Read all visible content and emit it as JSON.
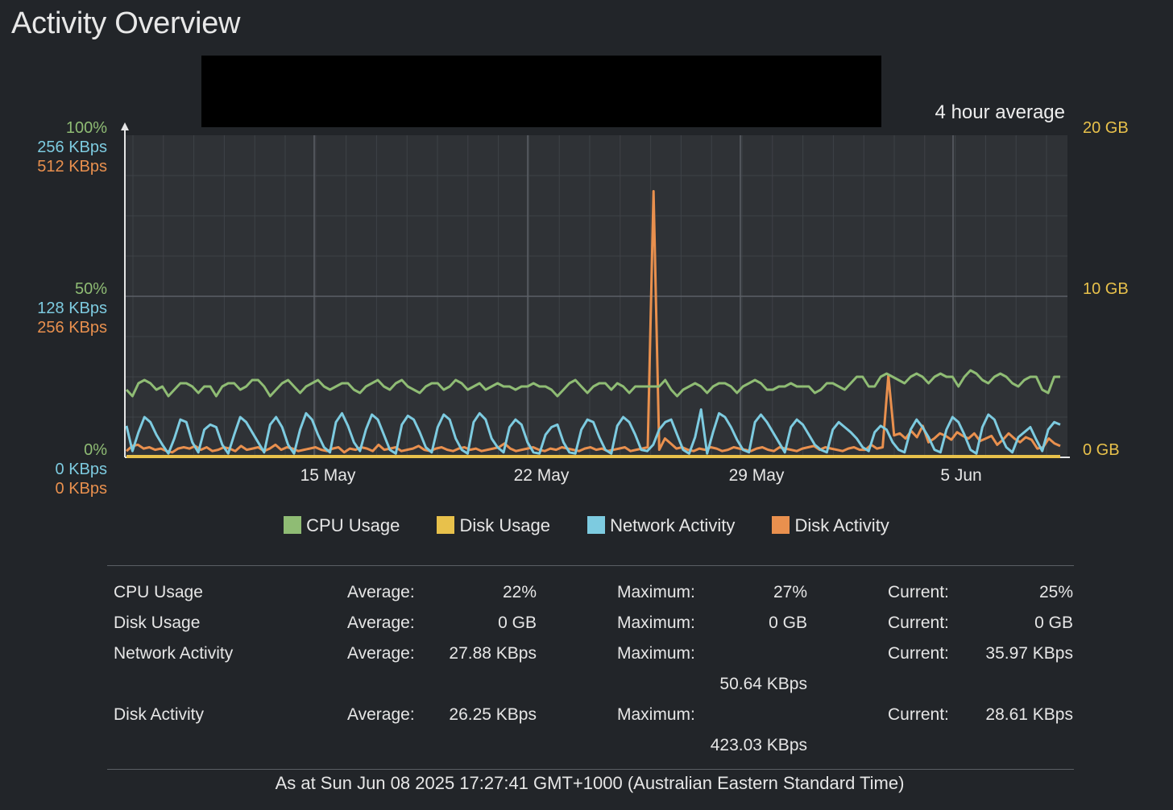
{
  "page": {
    "title": "Activity Overview",
    "average_label": "4 hour average"
  },
  "colors": {
    "cpu": "#8fbc74",
    "disk_usage": "#e8c14b",
    "network": "#7dcbe0",
    "disk_activity": "#e9904e"
  },
  "chart_data": {
    "type": "line",
    "title": "",
    "y_left_labels": {
      "top": [
        "100%",
        "256 KBps",
        "512 KBps"
      ],
      "mid": [
        "50%",
        "128 KBps",
        "256 KBps"
      ],
      "bottom": [
        "0%",
        "0 KBps",
        "0 KBps"
      ]
    },
    "y_right_labels": [
      "20 GB",
      "10 GB",
      "0 GB"
    ],
    "x_ticks": [
      "15 May",
      "22 May",
      "29 May",
      "5 Jun"
    ],
    "ylim_cpu": [
      0,
      100
    ],
    "ylim_network_kbps": [
      0,
      256
    ],
    "ylim_disk_activity_kbps": [
      0,
      512
    ],
    "ylim_disk_usage_gb": [
      0,
      20
    ],
    "grid": true,
    "series": [
      {
        "name": "CPU Usage",
        "unit": "%",
        "values": [
          21,
          19,
          23,
          24,
          23,
          21,
          22,
          19,
          21,
          23,
          23,
          22,
          20,
          22,
          22,
          19,
          22,
          23,
          23,
          21,
          22,
          24,
          24,
          22,
          19,
          21,
          23,
          24,
          22,
          20,
          22,
          23,
          24,
          22,
          21,
          22,
          23,
          23,
          21,
          20,
          22,
          23,
          24,
          22,
          21,
          23,
          24,
          22,
          21,
          20,
          22,
          23,
          23,
          21,
          22,
          24,
          23,
          21,
          22,
          23,
          21,
          22,
          23,
          22,
          22,
          21,
          22,
          22,
          23,
          22,
          22,
          21,
          19,
          21,
          23,
          24,
          22,
          20,
          22,
          23,
          23,
          21,
          23,
          22,
          20,
          22,
          22,
          22,
          22,
          22,
          24,
          21,
          19,
          21,
          22,
          23,
          22,
          20,
          22,
          23,
          23,
          22,
          20,
          22,
          23,
          24,
          23,
          21,
          21,
          22,
          22,
          23,
          22,
          22,
          22,
          20,
          21,
          23,
          23,
          22,
          21,
          23,
          25,
          25,
          22,
          22,
          25,
          26,
          25,
          24,
          23,
          25,
          26,
          25,
          23,
          25,
          26,
          25,
          25,
          22,
          25,
          27,
          26,
          24,
          23,
          25,
          26,
          25,
          23,
          22,
          24,
          25,
          25,
          21,
          20,
          25,
          25
        ]
      },
      {
        "name": "Disk Usage",
        "unit": "GB",
        "values": [
          0,
          0,
          0,
          0,
          0,
          0,
          0,
          0,
          0,
          0
        ]
      },
      {
        "name": "Network Activity",
        "unit": "KBps",
        "values": [
          25,
          5,
          20,
          32,
          28,
          18,
          10,
          3,
          15,
          30,
          28,
          12,
          4,
          22,
          26,
          24,
          10,
          3,
          18,
          32,
          28,
          20,
          12,
          4,
          26,
          32,
          24,
          10,
          3,
          22,
          35,
          30,
          18,
          8,
          4,
          28,
          35,
          25,
          12,
          5,
          22,
          34,
          30,
          18,
          6,
          3,
          26,
          33,
          30,
          20,
          8,
          4,
          24,
          34,
          30,
          15,
          6,
          3,
          28,
          35,
          30,
          15,
          8,
          4,
          24,
          30,
          26,
          12,
          4,
          3,
          18,
          24,
          26,
          12,
          4,
          3,
          22,
          30,
          28,
          16,
          6,
          3,
          25,
          32,
          28,
          18,
          6,
          5,
          10,
          22,
          28,
          30,
          18,
          6,
          3,
          16,
          38,
          3,
          20,
          35,
          32,
          24,
          14,
          6,
          4,
          28,
          34,
          28,
          20,
          12,
          4,
          24,
          30,
          26,
          18,
          10,
          6,
          4,
          22,
          28,
          24,
          20,
          15,
          8,
          5,
          20,
          25,
          22,
          12,
          6,
          4,
          22,
          30,
          24,
          16,
          6,
          4,
          22,
          32,
          28,
          18,
          6,
          3,
          24,
          34,
          30,
          18,
          8,
          4,
          16,
          20,
          24,
          14,
          5,
          22,
          28,
          26
        ]
      },
      {
        "name": "Disk Activity",
        "unit": "KBps",
        "values": [
          10,
          18,
          20,
          14,
          16,
          12,
          14,
          10,
          8,
          14,
          16,
          14,
          18,
          12,
          16,
          10,
          12,
          16,
          14,
          10,
          18,
          12,
          14,
          16,
          10,
          14,
          20,
          12,
          16,
          14,
          10,
          12,
          14,
          16,
          12,
          10,
          14,
          16,
          8,
          14,
          12,
          16,
          14,
          10,
          20,
          12,
          14,
          16,
          10,
          12,
          14,
          18,
          12,
          10,
          14,
          16,
          12,
          10,
          14,
          16,
          12,
          14,
          10,
          12,
          14,
          16,
          22,
          14,
          10,
          12,
          14,
          16,
          12,
          10,
          14,
          12,
          16,
          14,
          12,
          10,
          14,
          16,
          12,
          14,
          10,
          12,
          14,
          16,
          10,
          12,
          14,
          16,
          423,
          12,
          30,
          22,
          14,
          16,
          12,
          10,
          14,
          12,
          16,
          14,
          10,
          12,
          16,
          14,
          12,
          10,
          14,
          16,
          12,
          10,
          16,
          14,
          12,
          10,
          14,
          16,
          18,
          12,
          16,
          14,
          12,
          10,
          14,
          16,
          12,
          12,
          20,
          14,
          16,
          130,
          35,
          38,
          30,
          42,
          32,
          50,
          24,
          30,
          38,
          34,
          28,
          40,
          34,
          30,
          38,
          26,
          30,
          34,
          20,
          28,
          38,
          30,
          24,
          32,
          28,
          14,
          16,
          30,
          22,
          18
        ]
      }
    ]
  },
  "legend": [
    {
      "label": "CPU Usage",
      "color": "#8fbc74"
    },
    {
      "label": "Disk Usage",
      "color": "#e8c14b"
    },
    {
      "label": "Network Activity",
      "color": "#7dcbe0"
    },
    {
      "label": "Disk Activity",
      "color": "#e9904e"
    }
  ],
  "stats": {
    "average_label": "Average:",
    "maximum_label": "Maximum:",
    "current_label": "Current:",
    "rows": [
      {
        "name": "CPU Usage",
        "average": "22%",
        "maximum": "27%",
        "current": "25%"
      },
      {
        "name": "Disk Usage",
        "average": "0 GB",
        "maximum": "0 GB",
        "current": "0 GB"
      },
      {
        "name": "Network Activity",
        "average": "27.88 KBps",
        "maximum": "50.64 KBps",
        "current": "35.97 KBps"
      },
      {
        "name": "Disk Activity",
        "average": "26.25 KBps",
        "maximum": "423.03 KBps",
        "current": "28.61 KBps"
      }
    ]
  },
  "footer": "As at Sun Jun 08 2025 17:27:41 GMT+1000 (Australian Eastern Standard Time)"
}
